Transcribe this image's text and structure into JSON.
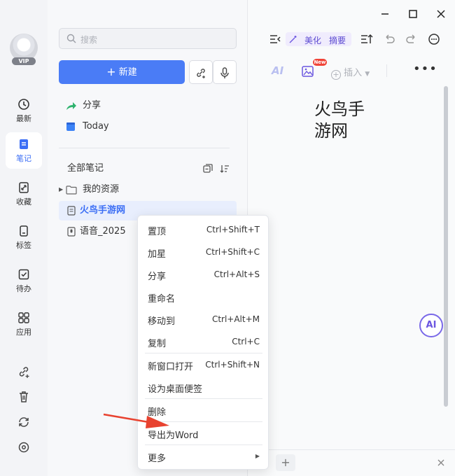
{
  "window": {
    "minimize_label": "minimize",
    "maximize_label": "maximize",
    "close_label": "close"
  },
  "rail": {
    "vip_badge": "VIP",
    "nav": [
      {
        "label": "最新",
        "icon": "clock-icon"
      },
      {
        "label": "笔记",
        "icon": "note-icon",
        "active": true
      },
      {
        "label": "收藏",
        "icon": "link-icon"
      },
      {
        "label": "标签",
        "icon": "tag-icon"
      },
      {
        "label": "待办",
        "icon": "checkbox-icon"
      },
      {
        "label": "应用",
        "icon": "apps-icon"
      }
    ],
    "bottom_icons": [
      "link-plus-icon",
      "trash-icon",
      "sync-icon",
      "settings-icon"
    ]
  },
  "middle": {
    "search_placeholder": "搜索",
    "new_button": "新建",
    "shortcuts": [
      {
        "label": "分享",
        "icon": "share-arrow-icon"
      },
      {
        "label": "Today",
        "icon": "calendar-note-icon"
      }
    ],
    "all_notes_label": "全部笔记",
    "tree": [
      {
        "label": "我的资源",
        "icon": "folder-icon"
      },
      {
        "label": "火鸟手游网",
        "icon": "doc-icon",
        "selected": true
      },
      {
        "label": "语音_2025",
        "icon": "voice-doc-icon"
      }
    ]
  },
  "toolbar": {
    "beauty_label": "美化",
    "summary_label": "摘要",
    "insert_label": "插入",
    "ai_label": "AI",
    "new_badge": "New"
  },
  "editor": {
    "title_line1": "火鸟手",
    "title_line2": "游网",
    "ai_bubble": "AI"
  },
  "context_menu": {
    "items": [
      {
        "label": "置顶",
        "shortcut": "Ctrl+Shift+T"
      },
      {
        "label": "加星",
        "shortcut": "Ctrl+Shift+C"
      },
      {
        "label": "分享",
        "shortcut": "Ctrl+Alt+S"
      },
      {
        "label": "重命名",
        "shortcut": ""
      },
      {
        "label": "移动到",
        "shortcut": "Ctrl+Alt+M"
      },
      {
        "label": "复制",
        "shortcut": "Ctrl+C"
      },
      {
        "label": "新窗口打开",
        "shortcut": "Ctrl+Shift+N"
      },
      {
        "label": "设为桌面便签",
        "shortcut": ""
      },
      {
        "label": "删除",
        "shortcut": ""
      },
      {
        "label": "导出为Word",
        "shortcut": ""
      },
      {
        "label": "更多",
        "shortcut": ""
      }
    ]
  },
  "colors": {
    "accent": "#4a7cf6",
    "ai_purple": "#6b56e0",
    "annotation_arrow": "#e8422f"
  }
}
